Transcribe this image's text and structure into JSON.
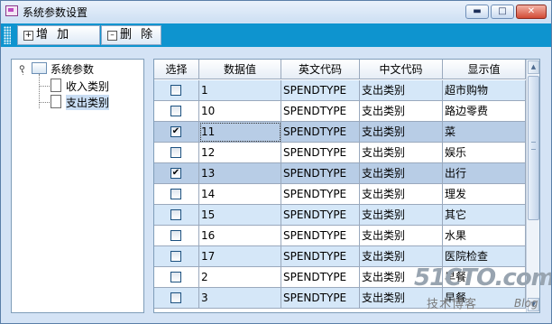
{
  "window": {
    "title": "系统参数设置",
    "minimize_icon": "minimize-icon",
    "maximize_icon": "maximize-icon",
    "close_icon": "close-icon"
  },
  "toolbar": {
    "add_label": "增 加",
    "delete_label": "删 除"
  },
  "tree": {
    "root_label": "系统参数",
    "children": [
      {
        "label": "收入类别",
        "selected": false
      },
      {
        "label": "支出类别",
        "selected": true
      }
    ]
  },
  "grid": {
    "columns": [
      "选择",
      "数据值",
      "英文代码",
      "中文代码",
      "显示值"
    ],
    "rows": [
      {
        "checked": false,
        "value": "1",
        "en": "SPENDTYPE",
        "cn": "支出类别",
        "display": "超市购物"
      },
      {
        "checked": false,
        "value": "10",
        "en": "SPENDTYPE",
        "cn": "支出类别",
        "display": "路边零费"
      },
      {
        "checked": true,
        "value": "11",
        "en": "SPENDTYPE",
        "cn": "支出类别",
        "display": "菜"
      },
      {
        "checked": false,
        "value": "12",
        "en": "SPENDTYPE",
        "cn": "支出类别",
        "display": "娱乐"
      },
      {
        "checked": true,
        "value": "13",
        "en": "SPENDTYPE",
        "cn": "支出类别",
        "display": "出行"
      },
      {
        "checked": false,
        "value": "14",
        "en": "SPENDTYPE",
        "cn": "支出类别",
        "display": "理发"
      },
      {
        "checked": false,
        "value": "15",
        "en": "SPENDTYPE",
        "cn": "支出类别",
        "display": "其它"
      },
      {
        "checked": false,
        "value": "16",
        "en": "SPENDTYPE",
        "cn": "支出类别",
        "display": "水果"
      },
      {
        "checked": false,
        "value": "17",
        "en": "SPENDTYPE",
        "cn": "支出类别",
        "display": "医院检查"
      },
      {
        "checked": false,
        "value": "2",
        "en": "SPENDTYPE",
        "cn": "支出类别",
        "display": "早餐"
      },
      {
        "checked": false,
        "value": "3",
        "en": "SPENDTYPE",
        "cn": "支出类别",
        "display": "早餐"
      }
    ]
  },
  "watermark": {
    "main": "51CTO.com",
    "sub": "技术博客",
    "blog": "Blog"
  },
  "colors": {
    "toolbar": "#0e94cf",
    "row_alt": "#d5e7f8",
    "row_selected": "#b8cde6"
  }
}
